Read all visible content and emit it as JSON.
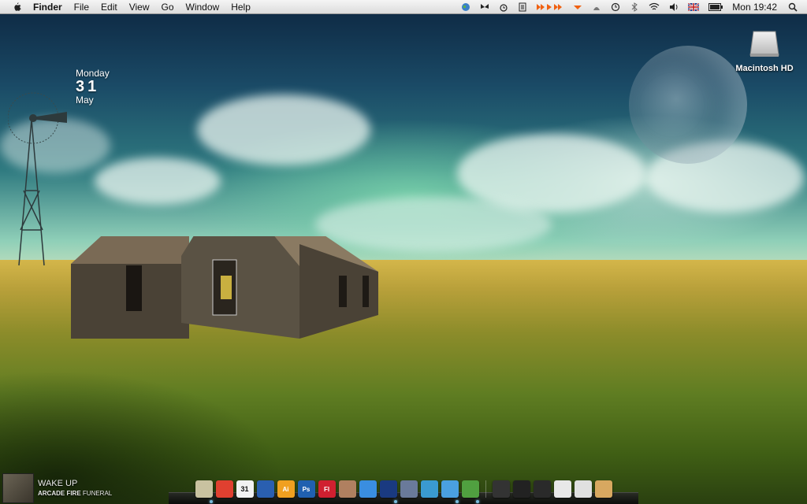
{
  "menubar": {
    "app_name": "Finder",
    "menus": [
      "File",
      "Edit",
      "View",
      "Go",
      "Window",
      "Help"
    ],
    "clock": "Mon 19:42",
    "status_icons": [
      "globe-icon",
      "butterfly-icon",
      "alarm-icon",
      "notes-icon",
      "media-controls-icon",
      "eject-icon",
      "time-machine-icon",
      "bluetooth-icon",
      "wifi-icon",
      "volume-icon",
      "uk-flag-icon",
      "battery-icon",
      "spotlight-icon"
    ]
  },
  "date_widget": {
    "weekday": "Monday",
    "day": "31",
    "month": "May"
  },
  "desktop_icons": [
    {
      "label": "Macintosh HD",
      "icon": "hard-drive-icon"
    }
  ],
  "now_playing": {
    "title": "WAKE UP",
    "artist": "ARCADE FIRE",
    "album": "FUNERAL"
  },
  "dock": {
    "items": [
      {
        "name": "finder-icon",
        "color": "#c9c2a0"
      },
      {
        "name": "gmail-icon",
        "color": "#e04030"
      },
      {
        "name": "calendar-icon",
        "color": "#f2f2f2",
        "text": "31"
      },
      {
        "name": "tasks-icon",
        "color": "#2a5fb0"
      },
      {
        "name": "illustrator-icon",
        "color": "#f0a020",
        "text": "Ai"
      },
      {
        "name": "photoshop-icon",
        "color": "#2060b0",
        "text": "Ps"
      },
      {
        "name": "flash-icon",
        "color": "#d02030",
        "text": "Fl"
      },
      {
        "name": "preview-icon",
        "color": "#b08060"
      },
      {
        "name": "textedit-icon",
        "color": "#3a8ee0"
      },
      {
        "name": "safari-icon",
        "color": "#1a3a80"
      },
      {
        "name": "script-icon",
        "color": "#6a7a9a"
      },
      {
        "name": "wordpress-icon",
        "color": "#3a9ad0"
      },
      {
        "name": "itunes-icon",
        "color": "#4aa0e0"
      },
      {
        "name": "pencil-icon",
        "color": "#50a040"
      }
    ],
    "stacks": [
      {
        "name": "documents-stack-icon",
        "color": "#333333"
      },
      {
        "name": "downloads-stack-icon",
        "color": "#222222"
      },
      {
        "name": "applications-stack-icon",
        "color": "#2a2a2a"
      },
      {
        "name": "mail-stack-icon",
        "color": "#e8e8e8"
      },
      {
        "name": "calendar-stack-icon",
        "color": "#e0e0e0"
      },
      {
        "name": "trash-icon",
        "color": "#d8a860"
      }
    ]
  }
}
